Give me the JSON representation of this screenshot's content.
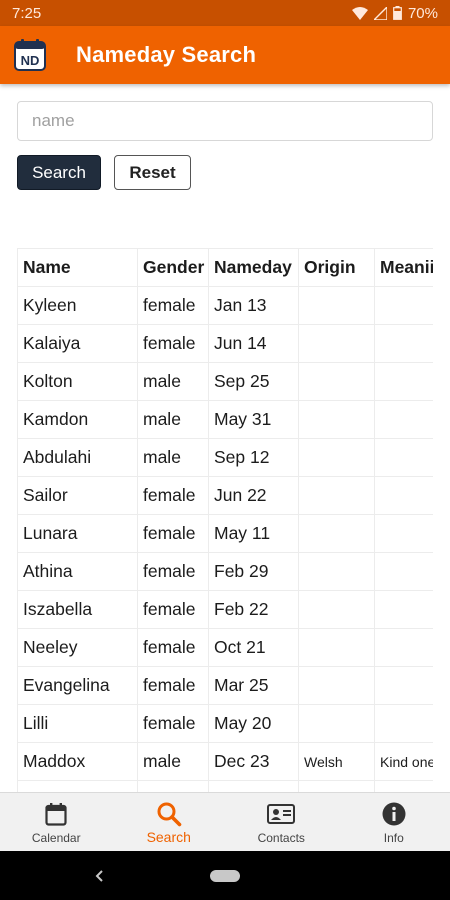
{
  "status_bar": {
    "time": "7:25",
    "battery": "70%"
  },
  "app_bar": {
    "logo_text": "ND",
    "title": "Nameday Search"
  },
  "search": {
    "placeholder": "name",
    "value": "",
    "search_label": "Search",
    "reset_label": "Reset"
  },
  "table": {
    "headers": [
      "Name",
      "Gender",
      "Nameday",
      "Origin",
      "Meanii"
    ],
    "rows": [
      [
        "Kyleen",
        "female",
        "Jan 13",
        "",
        ""
      ],
      [
        "Kalaiya",
        "female",
        "Jun 14",
        "",
        ""
      ],
      [
        "Kolton",
        "male",
        "Sep 25",
        "",
        ""
      ],
      [
        "Kamdon",
        "male",
        "May 31",
        "",
        ""
      ],
      [
        "Abdulahi",
        "male",
        "Sep 12",
        "",
        ""
      ],
      [
        "Sailor",
        "female",
        "Jun 22",
        "",
        ""
      ],
      [
        "Lunara",
        "female",
        "May 11",
        "",
        ""
      ],
      [
        "Athina",
        "female",
        "Feb 29",
        "",
        ""
      ],
      [
        "Iszabella",
        "female",
        "Feb 22",
        "",
        ""
      ],
      [
        "Neeley",
        "female",
        "Oct 21",
        "",
        ""
      ],
      [
        "Evangelina",
        "female",
        "Mar 25",
        "",
        ""
      ],
      [
        "Lilli",
        "female",
        "May 20",
        "",
        ""
      ],
      [
        "Maddox",
        "male",
        "Dec 23",
        "Welsh",
        "Kind one"
      ],
      [
        "",
        "",
        "",
        "",
        ""
      ]
    ]
  },
  "bottom_nav": [
    {
      "label": "Calendar",
      "icon": "calendar-icon",
      "active": false
    },
    {
      "label": "Search",
      "icon": "search-icon",
      "active": true
    },
    {
      "label": "Contacts",
      "icon": "contact-card-icon",
      "active": false
    },
    {
      "label": "Info",
      "icon": "info-icon",
      "active": false
    }
  ],
  "colors": {
    "accent": "#ef6200",
    "status_bar": "#c75000",
    "search_button": "#212d3d"
  }
}
